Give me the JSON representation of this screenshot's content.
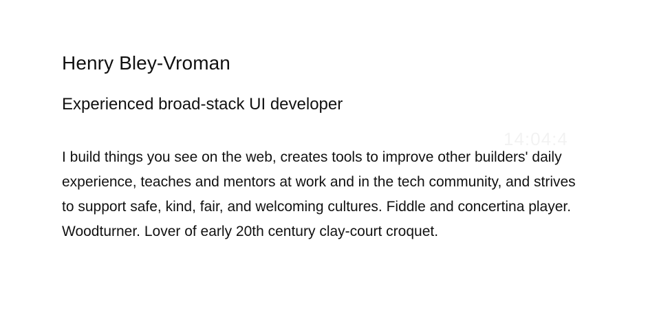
{
  "profile": {
    "name": "Henry Bley-Vroman",
    "tagline": "Experienced broad-stack UI developer",
    "bio": "I build things you see on the web, creates tools to improve other builders' daily experience, teaches and mentors at work and in the tech community, and strives to support safe, kind, fair, and welcoming cultures. Fiddle and concertina player. Woodturner. Lover of early 20th century clay-court croquet."
  },
  "watermark": {
    "text": "14:04:4"
  }
}
